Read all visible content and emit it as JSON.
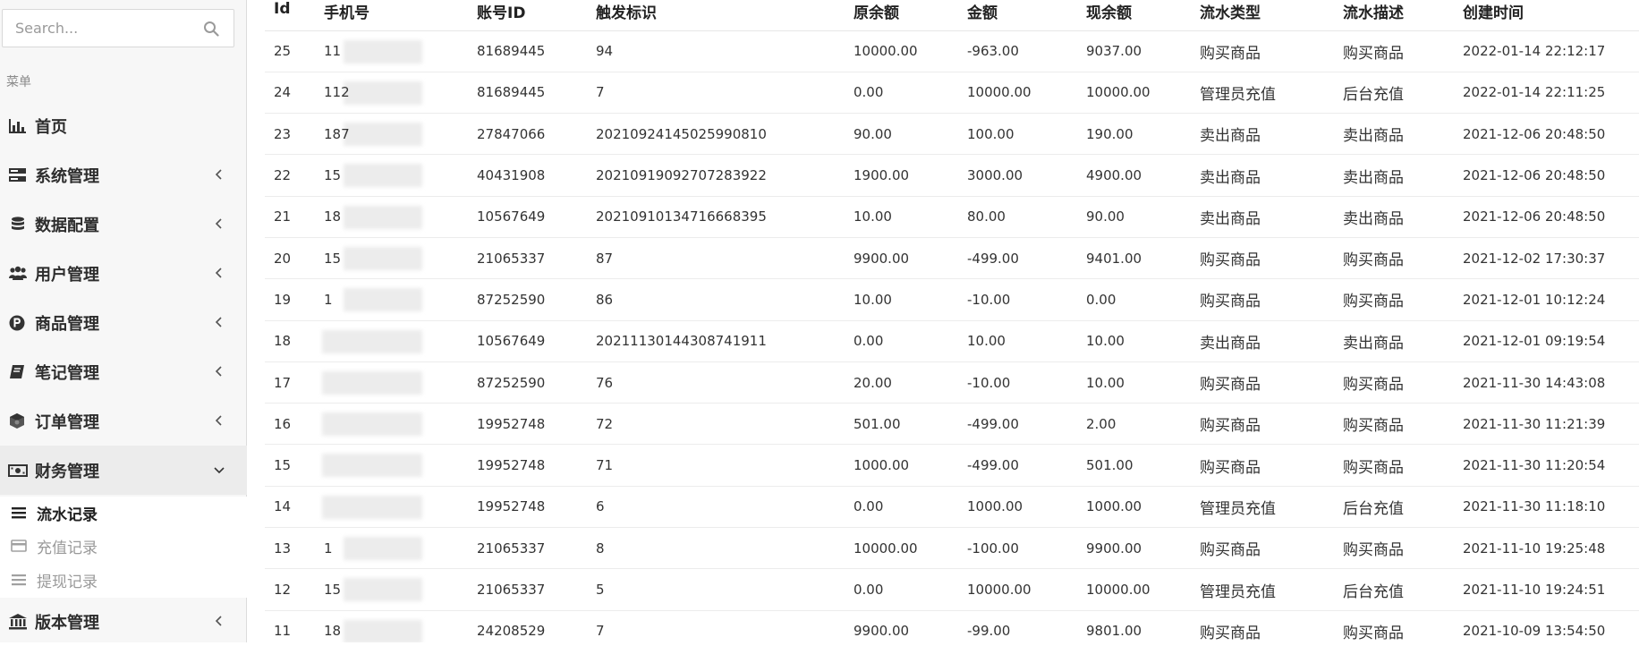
{
  "search": {
    "placeholder": "Search..."
  },
  "sidebar": {
    "menu_title": "菜单",
    "items": [
      {
        "label": "首页",
        "icon": "bar-chart-icon",
        "has_chevron": false
      },
      {
        "label": "系统管理",
        "icon": "server-icon",
        "has_chevron": true
      },
      {
        "label": "数据配置",
        "icon": "database-icon",
        "has_chevron": true
      },
      {
        "label": "用户管理",
        "icon": "users-icon",
        "has_chevron": true
      },
      {
        "label": "商品管理",
        "icon": "product-p-icon",
        "has_chevron": true
      },
      {
        "label": "笔记管理",
        "icon": "book-icon",
        "has_chevron": true
      },
      {
        "label": "订单管理",
        "icon": "cube-icon",
        "has_chevron": true
      },
      {
        "label": "财务管理",
        "icon": "money-icon",
        "has_chevron": true,
        "expanded": true
      },
      {
        "label": "版本管理",
        "icon": "bank-icon",
        "has_chevron": true
      }
    ],
    "sub_items": [
      {
        "label": "流水记录",
        "icon": "list-icon",
        "current": true
      },
      {
        "label": "充值记录",
        "icon": "card-icon",
        "current": false
      },
      {
        "label": "提现记录",
        "icon": "list-icon",
        "current": false
      }
    ]
  },
  "table": {
    "columns": [
      "Id",
      "手机号",
      "账号ID",
      "触发标识",
      "原余额",
      "金额",
      "现余额",
      "流水类型",
      "流水描述",
      "创建时间"
    ],
    "rows": [
      {
        "id": "25",
        "phone_prefix": "11",
        "account_id": "81689445",
        "trigger": "94",
        "before": "10000.00",
        "amount": "-963.00",
        "after": "9037.00",
        "type": "购买商品",
        "desc": "购买商品",
        "created": "2022-01-14 22:12:17"
      },
      {
        "id": "24",
        "phone_prefix": "112",
        "account_id": "81689445",
        "trigger": "7",
        "before": "0.00",
        "amount": "10000.00",
        "after": "10000.00",
        "type": "管理员充值",
        "desc": "后台充值",
        "created": "2022-01-14 22:11:25"
      },
      {
        "id": "23",
        "phone_prefix": "187",
        "account_id": "27847066",
        "trigger": "20210924145025990810",
        "before": "90.00",
        "amount": "100.00",
        "after": "190.00",
        "type": "卖出商品",
        "desc": "卖出商品",
        "created": "2021-12-06 20:48:50"
      },
      {
        "id": "22",
        "phone_prefix": "15",
        "account_id": "40431908",
        "trigger": "20210919092707283922",
        "before": "1900.00",
        "amount": "3000.00",
        "after": "4900.00",
        "type": "卖出商品",
        "desc": "卖出商品",
        "created": "2021-12-06 20:48:50"
      },
      {
        "id": "21",
        "phone_prefix": "18",
        "account_id": "10567649",
        "trigger": "20210910134716668395",
        "before": "10.00",
        "amount": "80.00",
        "after": "90.00",
        "type": "卖出商品",
        "desc": "卖出商品",
        "created": "2021-12-06 20:48:50"
      },
      {
        "id": "20",
        "phone_prefix": "15",
        "account_id": "21065337",
        "trigger": "87",
        "before": "9900.00",
        "amount": "-499.00",
        "after": "9401.00",
        "type": "购买商品",
        "desc": "购买商品",
        "created": "2021-12-02 17:30:37"
      },
      {
        "id": "19",
        "phone_prefix": "1",
        "account_id": "87252590",
        "trigger": "86",
        "before": "10.00",
        "amount": "-10.00",
        "after": "0.00",
        "type": "购买商品",
        "desc": "购买商品",
        "created": "2021-12-01 10:12:24"
      },
      {
        "id": "18",
        "phone_prefix": "",
        "account_id": "10567649",
        "trigger": "20211130144308741911",
        "before": "0.00",
        "amount": "10.00",
        "after": "10.00",
        "type": "卖出商品",
        "desc": "卖出商品",
        "created": "2021-12-01 09:19:54"
      },
      {
        "id": "17",
        "phone_prefix": "",
        "account_id": "87252590",
        "trigger": "76",
        "before": "20.00",
        "amount": "-10.00",
        "after": "10.00",
        "type": "购买商品",
        "desc": "购买商品",
        "created": "2021-11-30 14:43:08"
      },
      {
        "id": "16",
        "phone_prefix": "",
        "account_id": "19952748",
        "trigger": "72",
        "before": "501.00",
        "amount": "-499.00",
        "after": "2.00",
        "type": "购买商品",
        "desc": "购买商品",
        "created": "2021-11-30 11:21:39"
      },
      {
        "id": "15",
        "phone_prefix": "",
        "account_id": "19952748",
        "trigger": "71",
        "before": "1000.00",
        "amount": "-499.00",
        "after": "501.00",
        "type": "购买商品",
        "desc": "购买商品",
        "created": "2021-11-30 11:20:54"
      },
      {
        "id": "14",
        "phone_prefix": "",
        "account_id": "19952748",
        "trigger": "6",
        "before": "0.00",
        "amount": "1000.00",
        "after": "1000.00",
        "type": "管理员充值",
        "desc": "后台充值",
        "created": "2021-11-30 11:18:10"
      },
      {
        "id": "13",
        "phone_prefix": "1",
        "account_id": "21065337",
        "trigger": "8",
        "before": "10000.00",
        "amount": "-100.00",
        "after": "9900.00",
        "type": "购买商品",
        "desc": "购买商品",
        "created": "2021-11-10 19:25:48"
      },
      {
        "id": "12",
        "phone_prefix": "15",
        "account_id": "21065337",
        "trigger": "5",
        "before": "0.00",
        "amount": "10000.00",
        "after": "10000.00",
        "type": "管理员充值",
        "desc": "后台充值",
        "created": "2021-11-10 19:24:51"
      },
      {
        "id": "11",
        "phone_prefix": "18",
        "account_id": "24208529",
        "trigger": "7",
        "before": "9900.00",
        "amount": "-99.00",
        "after": "9801.00",
        "type": "购买商品",
        "desc": "购买商品",
        "created": "2021-10-09 13:54:50"
      }
    ]
  }
}
